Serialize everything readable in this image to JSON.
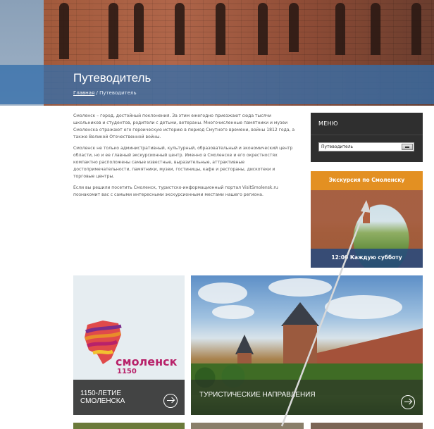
{
  "hero": {
    "title": "Путеводитель",
    "breadcrumb": {
      "home": "Главная",
      "separator": "/",
      "current": "Путеводитель"
    }
  },
  "intro": {
    "paragraphs": [
      "Смоленск – город, достойный поклонения. За этим ежегодно приезжают сюда тысячи школьников и студентов, родители с детьми, ветераны. Многочисленные памятники и музеи Смоленска отражают его героическую историю в период Смутного времени, войны 1812 года, а также Великой Отечественной войны.",
      "Смоленск не только административный, культурный, образовательный и экономический центр области, но и ее главный экскурсионный центр. Именно в Смоленске и его окрестностях компактно расположены самые известные, выразительные, аттрактивные достопримечательности, памятники, музеи, гостиницы, кафе и рестораны, дискотеки и торговые центры.",
      "Если вы решили посетить Смоленск, туристско-информационный портал VisitSmolensk.ru познакомит вас с самыми интересными экскурсионными местами нашего региона."
    ]
  },
  "menu": {
    "title": "МЕНЮ",
    "selected": "Путеводитель"
  },
  "promo": {
    "title": "Экскурсия по Смоленску",
    "schedule": "12:00 Каждую субботу"
  },
  "tiles": [
    {
      "label_line1": "1150-ЛЕТИЕ",
      "label_line2": "СМОЛЕНСКА",
      "logo_text": "смоленск",
      "logo_year": "1150"
    },
    {
      "label_line1": "ТУРИСТИЧЕСКИЕ НАПРАВЛЕНИЯ"
    }
  ],
  "colors": {
    "hero_band": "#346eaa",
    "menu_bg": "#2f2f2f",
    "promo_header": "#e39022",
    "promo_footer": "#244a80",
    "logo_accent": "#b8226a"
  }
}
